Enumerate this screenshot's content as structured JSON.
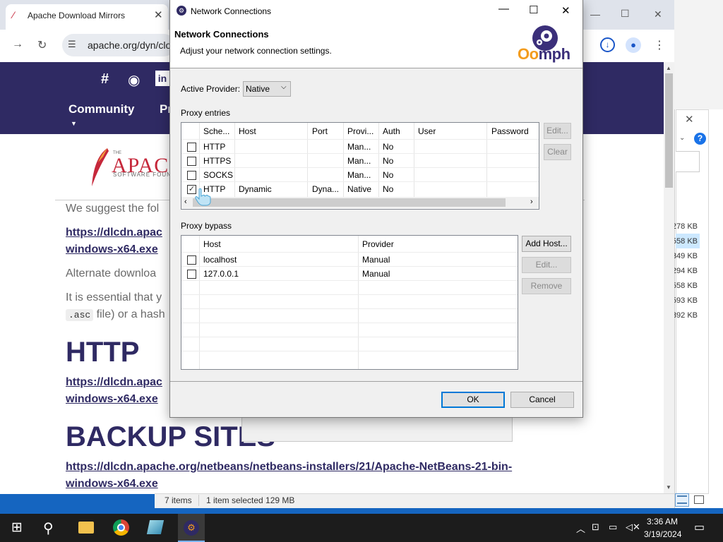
{
  "explorer": {
    "sizes": [
      "278 KB",
      "558 KB",
      "349 KB",
      "294 KB",
      "558 KB",
      "593 KB",
      "392 KB"
    ],
    "help_glyph": "?"
  },
  "chrome": {
    "tab_title": "Apache Download Mirrors",
    "url": "apache.org/dyn/clo",
    "nav": {
      "community": "Community",
      "projects": "Pr"
    }
  },
  "apache_logo": {
    "the": "THE",
    "word": "APACH",
    "sub": "SOFTWARE FOUNDA"
  },
  "page": {
    "suggest": "We suggest the fol",
    "link1_a": "https://dlcdn.apac",
    "link1_b": "windows-x64.exe",
    "alternate": "Alternate downloa",
    "essential": "It is essential that y",
    "asc_chip": ".asc",
    "asc_rest": "file) or a hash",
    "http_heading": "HTTP",
    "link2_a": "https://dlcdn.apac",
    "link2_b": "windows-x64.exe",
    "backup_heading": "BACKUP SITES",
    "link3_a": "https://dlcdn.apache.org/netbeans/netbeans-installers/21/Apache-NetBeans-21-bin-",
    "link3_b": "windows-x64.exe"
  },
  "statusbar": {
    "items": "7 items",
    "selected": "1 item selected  129 MB"
  },
  "dialog": {
    "title": "Network Connections",
    "heading": "Network Connections",
    "description": "Adjust your network connection settings.",
    "logo_text_1": "Oo",
    "logo_text_2": "mph",
    "active_provider_label": "Active Provider:",
    "active_provider_value": "Native",
    "proxy_entries_label": "Proxy entries",
    "proxy_columns": [
      "Sche...",
      "Host",
      "Port",
      "Provi...",
      "Auth",
      "User",
      "Password"
    ],
    "proxy_rows": [
      {
        "checked": false,
        "scheme": "HTTP",
        "host": "",
        "port": "",
        "provider": "Man...",
        "auth": "No",
        "user": "",
        "password": ""
      },
      {
        "checked": false,
        "scheme": "HTTPS",
        "host": "",
        "port": "",
        "provider": "Man...",
        "auth": "No",
        "user": "",
        "password": ""
      },
      {
        "checked": false,
        "scheme": "SOCKS",
        "host": "",
        "port": "",
        "provider": "Man...",
        "auth": "No",
        "user": "",
        "password": ""
      },
      {
        "checked": true,
        "scheme": "HTTP",
        "host": "Dynamic",
        "port": "Dyna...",
        "provider": "Native",
        "auth": "No",
        "user": "",
        "password": ""
      }
    ],
    "edit_label": "Edit...",
    "clear_label": "Clear",
    "proxy_bypass_label": "Proxy bypass",
    "bypass_columns": [
      "Host",
      "Provider"
    ],
    "bypass_rows": [
      {
        "checked": false,
        "host": "localhost",
        "provider": "Manual"
      },
      {
        "checked": false,
        "host": "127.0.0.1",
        "provider": "Manual"
      }
    ],
    "add_host_label": "Add Host...",
    "bypass_edit_label": "Edit...",
    "remove_label": "Remove",
    "ok_label": "OK",
    "cancel_label": "Cancel"
  },
  "taskbar": {
    "time": "3:36 AM",
    "date": "3/19/2024"
  }
}
